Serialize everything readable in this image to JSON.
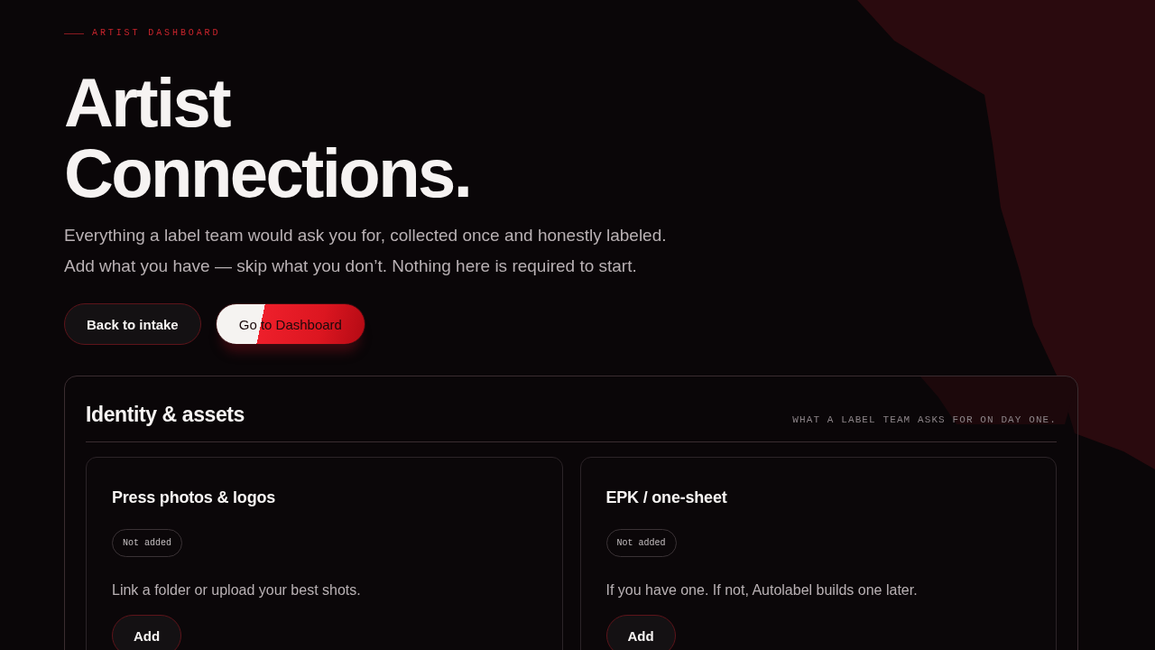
{
  "eyebrow": "ARTIST DASHBOARD",
  "title": "Artist Connections.",
  "intro_lines": [
    "Everything a label team would ask you for, collected once and honestly labeled.",
    "Add what you have — skip what you don’t. Nothing here is required to start."
  ],
  "actions": [
    {
      "label": "Back to intake",
      "kind": "secondary"
    },
    {
      "label": "Go to Dashboard",
      "kind": "primary"
    }
  ],
  "section": {
    "title": "Identity & assets",
    "note": "WHAT A LABEL TEAM ASKS FOR ON DAY ONE.",
    "items": [
      {
        "title": "Press photos & logos",
        "status": "Not added",
        "description": "Link a folder or upload your best shots.",
        "action": "Add"
      },
      {
        "title": "EPK / one-sheet",
        "status": "Not added",
        "description": "If you have one. If not, Autolabel builds one later.",
        "action": "Add"
      }
    ]
  }
}
